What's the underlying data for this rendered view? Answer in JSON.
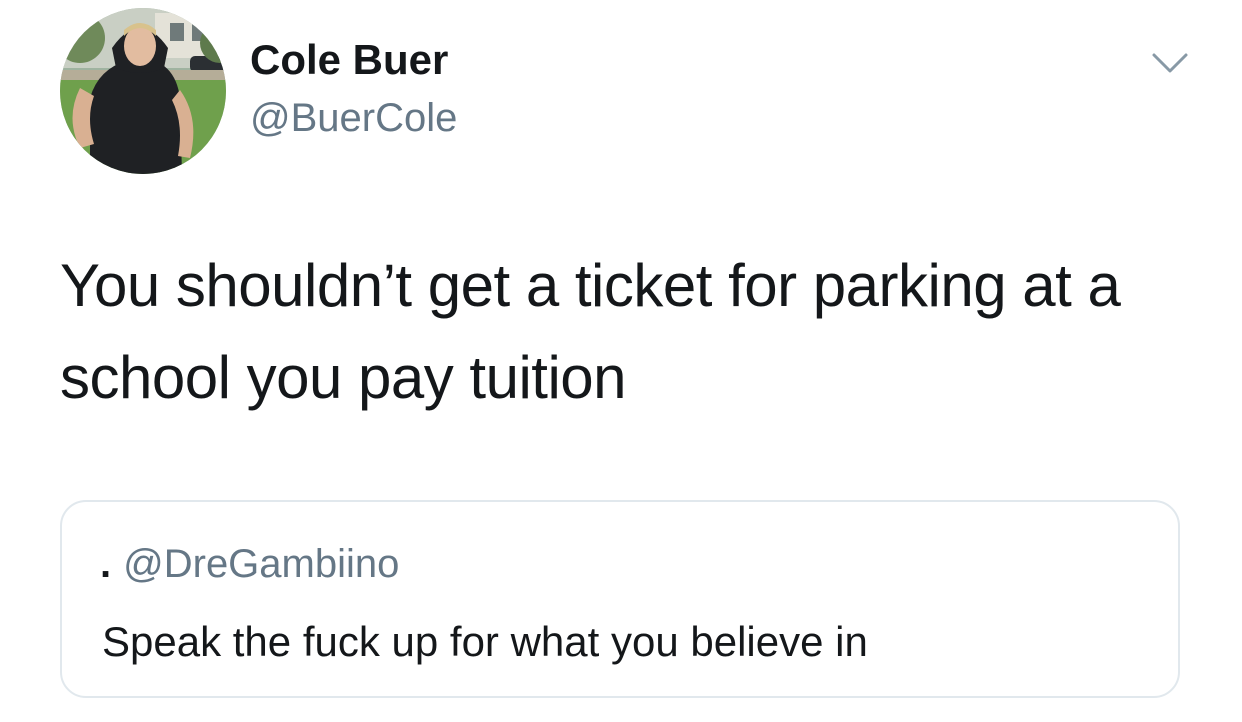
{
  "tweet": {
    "author": {
      "display_name": "Cole Buer",
      "handle": "@BuerCole",
      "avatar_icon": "profile-photo"
    },
    "menu_icon": "chevron-down-icon",
    "text": "You shouldn’t get a ticket for parking at a school you pay tuition",
    "quoted_tweet": {
      "display_name": ".",
      "handle": "@DreGambiino",
      "text": "Speak the fuck up for what you believe in"
    }
  },
  "colors": {
    "primary_text": "#14171a",
    "secondary_text": "#657786",
    "border": "#e1e8ed",
    "background": "#ffffff"
  }
}
